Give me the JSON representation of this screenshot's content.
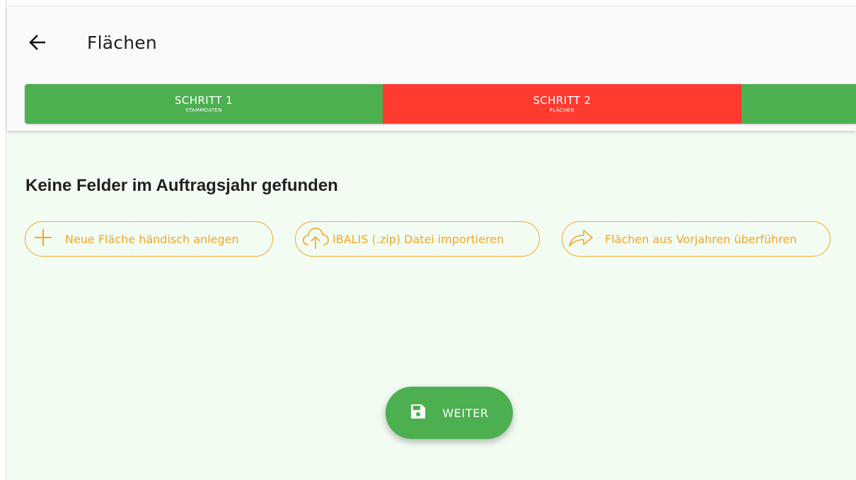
{
  "header": {
    "title": "Flächen",
    "back_icon": "arrow-left-icon"
  },
  "stepper": {
    "steps": [
      {
        "title": "SCHRITT 1",
        "subtitle": "STAMMDATEN",
        "color": "#4caf50"
      },
      {
        "title": "SCHRITT 2",
        "subtitle": "FLÄCHEN",
        "color": "#ff3b30"
      },
      {
        "title": "",
        "subtitle": "",
        "color": "#4caf50"
      }
    ]
  },
  "main": {
    "headline": "Keine Felder im Auftragsjahr gefunden",
    "actions": [
      {
        "label": "Neue Fläche händisch anlegen",
        "icon": "plus-icon"
      },
      {
        "label": "IBALIS (.zip) Datei importieren",
        "icon": "cloud-upload-icon"
      },
      {
        "label": "Flächen aus Vorjahren überführen",
        "icon": "share-arrow-icon"
      }
    ],
    "accent_color": "#f5a623",
    "background_color": "#f2fcf3"
  },
  "fab": {
    "label": "WEITER",
    "icon": "save-icon",
    "color": "#4caf50"
  }
}
